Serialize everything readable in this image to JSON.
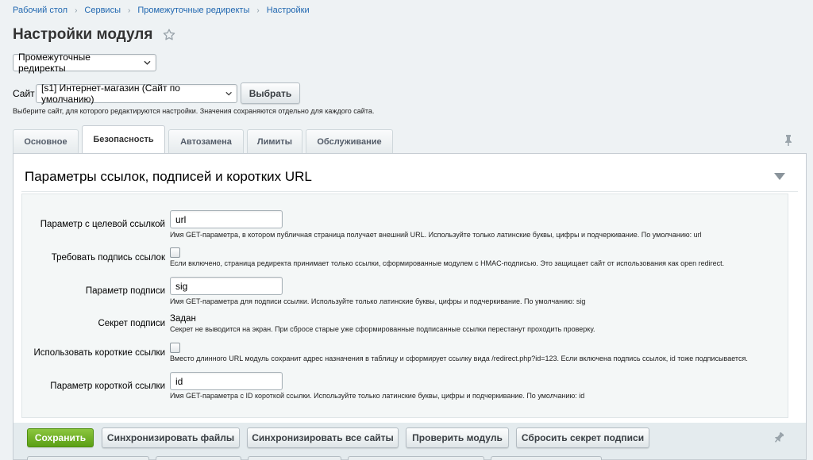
{
  "breadcrumb": [
    "Рабочий стол",
    "Сервисы",
    "Промежуточные редиректы",
    "Настройки"
  ],
  "page_title": "Настройки модуля",
  "module_select": {
    "value": "Промежуточные редиректы"
  },
  "site": {
    "label": "Сайт",
    "select_value": "[s1] Интернет-магазин (Сайт по умолчанию)",
    "choose_button": "Выбрать",
    "hint": "Выберите сайт, для которого редактируются настройки. Значения сохраняются отдельно для каждого сайта."
  },
  "tabs": [
    {
      "label": "Основное",
      "active": false
    },
    {
      "label": "Безопасность",
      "active": true
    },
    {
      "label": "Автозамена",
      "active": false
    },
    {
      "label": "Лимиты",
      "active": false
    },
    {
      "label": "Обслуживание",
      "active": false
    }
  ],
  "section": {
    "title": "Параметры ссылок, подписей и коротких URL",
    "fields": [
      {
        "label": "Параметр с целевой ссылкой",
        "type": "text",
        "value": "url",
        "description": "Имя GET-параметра, в котором публичная страница получает внешний URL. Используйте только латинские буквы, цифры и подчеркивание. По умолчанию: url"
      },
      {
        "label": "Требовать подпись ссылок",
        "type": "checkbox",
        "checked": false,
        "description": "Если включено, страница редиректа принимает только ссылки, сформированные модулем с HMAC-подписью. Это защищает сайт от использования как open redirect."
      },
      {
        "label": "Параметр подписи",
        "type": "text",
        "value": "sig",
        "description": "Имя GET-параметра для подписи ссылки. Используйте только латинские буквы, цифры и подчеркивание. По умолчанию: sig"
      },
      {
        "label": "Секрет подписи",
        "type": "static",
        "value": "Задан",
        "description": "Секрет не выводится на экран. При сбросе старые уже сформированные подписанные ссылки перестанут проходить проверку."
      },
      {
        "label": "Использовать короткие ссылки",
        "type": "checkbox",
        "checked": false,
        "description": "Вместо длинного URL модуль сохранит адрес назначения в таблицу и сформирует ссылку вида /redirect.php?id=123. Если включена подпись ссылок, id тоже подписывается."
      },
      {
        "label": "Параметр короткой ссылки",
        "type": "text",
        "value": "id",
        "description": "Имя GET-параметра с ID короткой ссылки. Используйте только латинские буквы, цифры и подчеркивание. По умолчанию: id"
      }
    ]
  },
  "footer_buttons": {
    "save": "Сохранить",
    "sync_files": "Синхронизировать файлы",
    "sync_all_sites": "Синхронизировать все сайты",
    "check_module": "Проверить модуль",
    "reset_secret": "Сбросить секрет подписи"
  },
  "icons": {
    "star": "star-icon",
    "pin": "pin-icon",
    "collapse": "triangle-down-icon",
    "chevron": "chevron-down-icon"
  },
  "colors": {
    "link": "#2067b0",
    "primary_button": "#6aaf1f",
    "background": "#eef2f4"
  }
}
